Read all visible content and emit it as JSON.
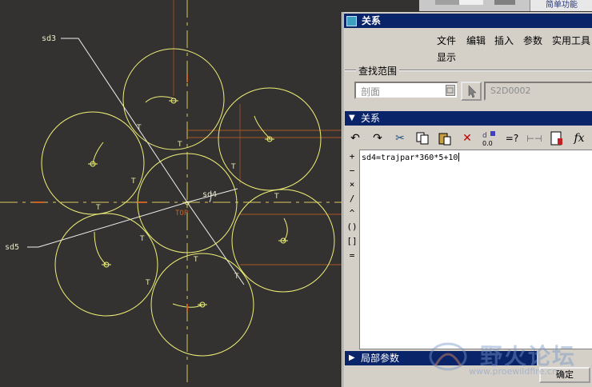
{
  "canvas": {
    "dimension_labels": {
      "sd3": "sd3",
      "sd5": "sd5",
      "sd4": "sd4",
      "top": "TOP"
    },
    "tangent_marker": "T",
    "colors": {
      "background": "#333230",
      "sketch": "#f0f078",
      "center_line": "#d8c860",
      "reference": "#c86020"
    }
  },
  "top_strip": {
    "tab_label": "简单功能"
  },
  "dialog": {
    "title": "关系",
    "menu": {
      "file": "文件",
      "edit": "编辑",
      "insert": "插入",
      "params": "参数",
      "utilities": "实用工具",
      "display": "显示"
    },
    "search_scope": {
      "legend": "查找范围",
      "section_value": "剖面",
      "sketch_id": "S2D0002"
    },
    "relations_section": {
      "title": "关系",
      "expression": "sd4=trajpar*360*5+10"
    },
    "toolbar_icons": [
      "undo-icon",
      "redo-icon",
      "cut-icon",
      "copy-icon",
      "paste-icon",
      "delete-icon",
      "evaluate-icon",
      "verify-icon",
      "dimension-icon",
      "sort-icon",
      "function-icon"
    ],
    "toolbar_glyphs": {
      "undo": "↶",
      "redo": "↷",
      "cut": "✂",
      "copy": "⎘",
      "paste": "📋",
      "delete": "✕",
      "switch_dims": "d",
      "switch_dims_sub": "0.0",
      "eval": "=?",
      "dim_line": "⊢⊣",
      "fx": "fx"
    },
    "operators": [
      "+",
      "−",
      "×",
      "/",
      "^",
      "()",
      "[]",
      "="
    ],
    "local_params": {
      "title": "局部参数"
    },
    "ok_button": "确定"
  },
  "watermark": {
    "main": "野火论坛",
    "url": "www.proewildfire.cn"
  }
}
